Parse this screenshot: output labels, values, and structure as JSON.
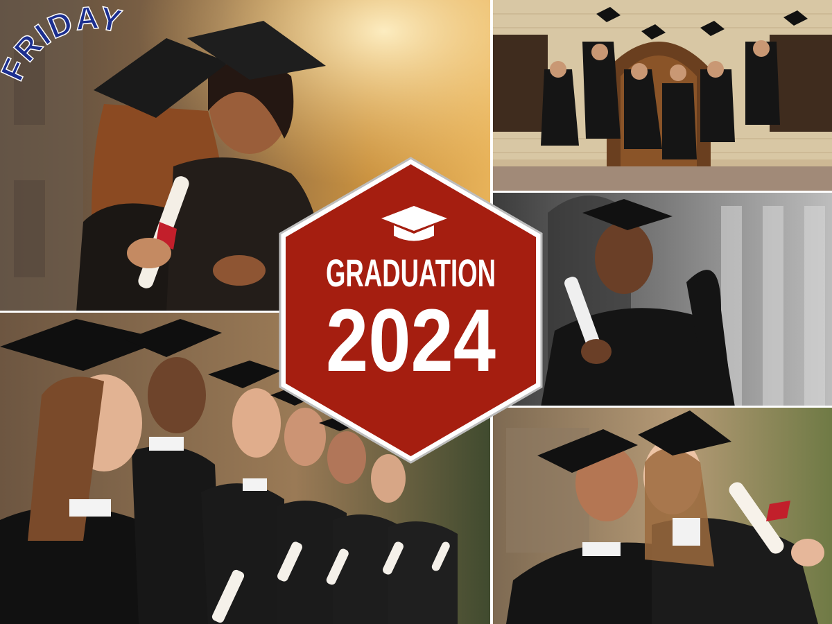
{
  "badge": {
    "title": "GRADUATION",
    "year": "2024",
    "icon": "graduation-cap-icon",
    "fill_color": "#a51e10",
    "border_color": "#c9c9c9"
  },
  "corner_label": {
    "text": "FRIDAY",
    "color": "#1c2f8f"
  },
  "photos": [
    {
      "name": "two-graduates-hugging-photo"
    },
    {
      "name": "graduates-jumping-photo"
    },
    {
      "name": "graduate-holding-cap-photo"
    },
    {
      "name": "graduates-in-row-photo"
    },
    {
      "name": "graduates-selfie-photo"
    }
  ]
}
